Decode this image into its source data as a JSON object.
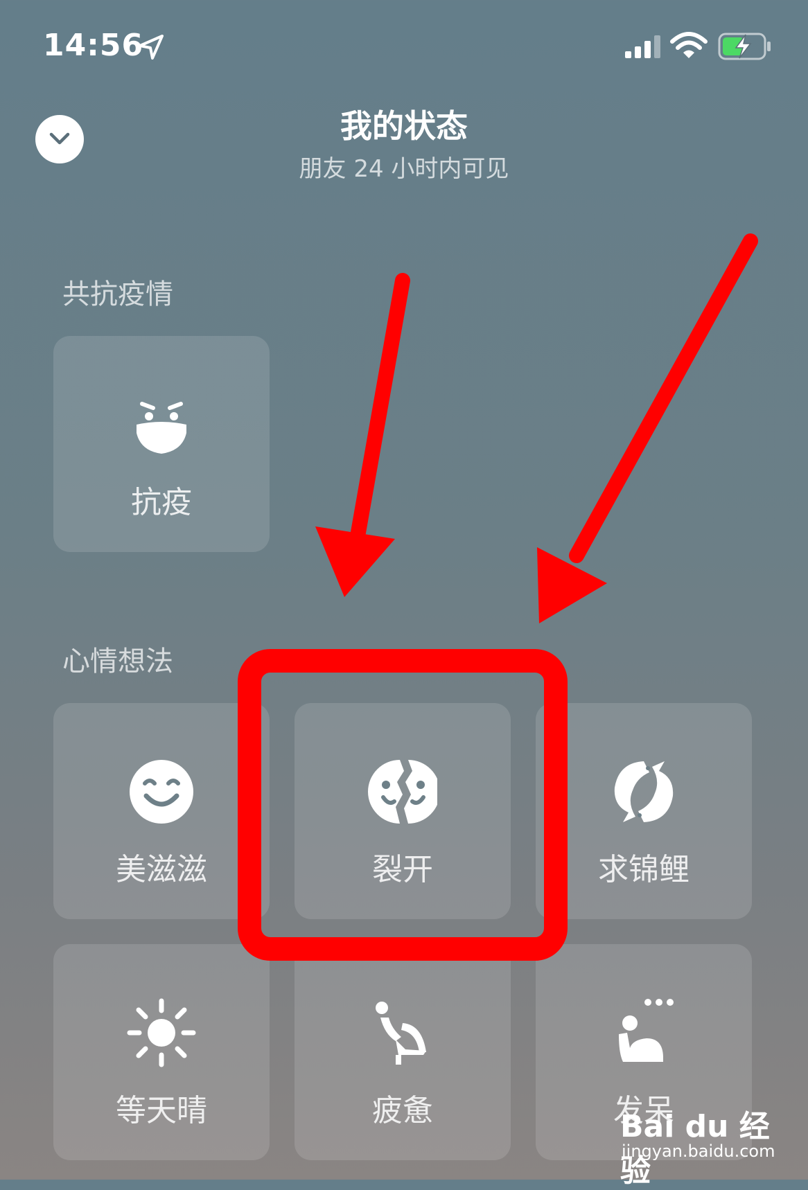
{
  "status_bar": {
    "time": "14:56",
    "icons": [
      "location-arrow-icon",
      "cellular-signal-icon",
      "wifi-icon",
      "battery-charging-icon"
    ],
    "battery_color": "#4cd964"
  },
  "header": {
    "collapse_icon": "chevron-down-icon",
    "title": "我的状态",
    "subtitle": "朋友 24 小时内可见"
  },
  "sections": [
    {
      "label": "共抗疫情",
      "tiles": [
        {
          "label": "抗疫",
          "icon": "masked-face-icon"
        }
      ]
    },
    {
      "label": "心情想法",
      "tiles": [
        {
          "label": "美滋滋",
          "icon": "smiling-face-icon"
        },
        {
          "label": "裂开",
          "icon": "cracked-face-icon"
        },
        {
          "label": "求锦鲤",
          "icon": "koi-fish-icon"
        },
        {
          "label": "等天晴",
          "icon": "sun-icon"
        },
        {
          "label": "疲惫",
          "icon": "tired-person-icon"
        },
        {
          "label": "发呆",
          "icon": "daydreaming-person-icon"
        }
      ]
    }
  ],
  "annotation": {
    "color": "#ff0000",
    "shapes": [
      "arrow",
      "arrow",
      "highlight-box"
    ]
  },
  "watermark": {
    "logo": "Bai du 经验",
    "url": "jingyan.baidu.com"
  }
}
